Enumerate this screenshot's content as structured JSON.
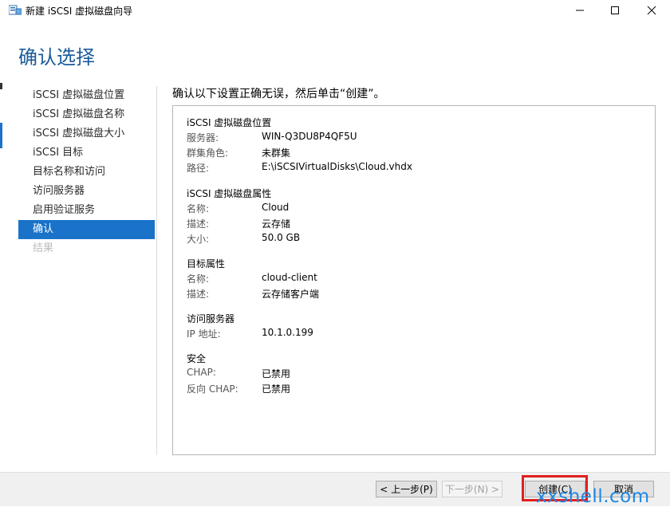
{
  "window": {
    "title": "新建 iSCSI 虚拟磁盘向导",
    "controls": [
      "minimize",
      "maximize",
      "close"
    ]
  },
  "page_title": "确认选择",
  "nav": {
    "items": [
      {
        "label": "iSCSI 虚拟磁盘位置",
        "state": "normal"
      },
      {
        "label": "iSCSI 虚拟磁盘名称",
        "state": "normal"
      },
      {
        "label": "iSCSI 虚拟磁盘大小",
        "state": "normal"
      },
      {
        "label": "iSCSI 目标",
        "state": "normal"
      },
      {
        "label": "目标名称和访问",
        "state": "normal"
      },
      {
        "label": "访问服务器",
        "state": "normal"
      },
      {
        "label": "启用验证服务",
        "state": "normal"
      },
      {
        "label": "确认",
        "state": "active"
      },
      {
        "label": "结果",
        "state": "disabled"
      }
    ]
  },
  "instruction": "确认以下设置正确无误，然后单击“创建”。",
  "summary": {
    "location": {
      "title": "iSCSI 虚拟磁盘位置",
      "server_label": "服务器:",
      "server_value": "WIN-Q3DU8P4QF5U",
      "cluster_label": "群集角色:",
      "cluster_value": "未群集",
      "path_label": "路径:",
      "path_value": "E:\\iSCSIVirtualDisks\\Cloud.vhdx"
    },
    "properties": {
      "title": "iSCSI 虚拟磁盘属性",
      "name_label": "名称:",
      "name_value": "Cloud",
      "desc_label": "描述:",
      "desc_value": "云存储",
      "size_label": "大小:",
      "size_value": "50.0 GB"
    },
    "target": {
      "title": "目标属性",
      "name_label": "名称:",
      "name_value": "cloud-client",
      "desc_label": "描述:",
      "desc_value": "云存储客户端"
    },
    "access": {
      "title": "访问服务器",
      "ip_label": "IP 地址:",
      "ip_value": "10.1.0.199"
    },
    "security": {
      "title": "安全",
      "chap_label": "CHAP:",
      "chap_value": "已禁用",
      "rchap_label": "反向 CHAP:",
      "rchap_value": "已禁用"
    }
  },
  "buttons": {
    "prev": "< 上一步(P)",
    "next": "下一步(N) >",
    "create": "创建(C)",
    "cancel": "取消"
  },
  "watermark": "xxshell.com",
  "colors": {
    "accent": "#1a73c9",
    "title": "#1a5b9b",
    "highlight": "#e01f1f"
  }
}
